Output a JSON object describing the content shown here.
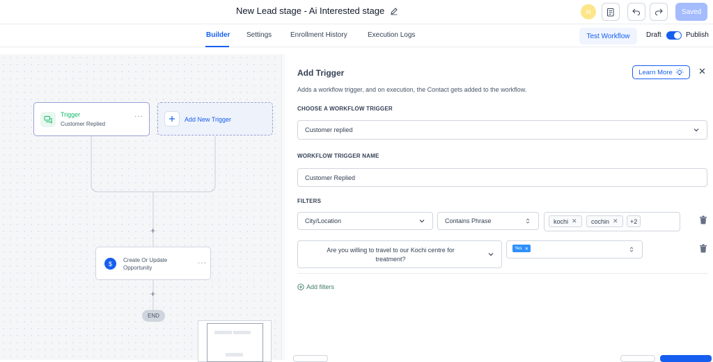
{
  "header": {
    "title": "New Lead stage - Ai Interested stage",
    "avatar_initials": "AI",
    "saved_label": "Saved"
  },
  "tabs": [
    {
      "label": "Builder",
      "active": true
    },
    {
      "label": "Settings",
      "active": false
    },
    {
      "label": "Enrollment History",
      "active": false
    },
    {
      "label": "Execution Logs",
      "active": false
    }
  ],
  "toolbar": {
    "test_workflow_label": "Test Workflow",
    "draft_label": "Draft",
    "publish_label": "Publish",
    "publish_toggle_on": true
  },
  "canvas": {
    "trigger_node": {
      "title": "Trigger",
      "subtitle": "Customer Replied"
    },
    "add_trigger_label": "Add New Trigger",
    "action_node": {
      "title_line1": "Create Or Update",
      "title_line2": "Opportunity"
    },
    "end_label": "END"
  },
  "panel": {
    "title": "Add Trigger",
    "learn_more_label": "Learn More",
    "description": "Adds a workflow trigger, and on execution, the Contact gets added to the workflow.",
    "choose_trigger_label": "CHOOSE A WORKFLOW TRIGGER",
    "trigger_value": "Customer replied",
    "trigger_name_label": "WORKFLOW TRIGGER NAME",
    "trigger_name_value": "Customer Replied",
    "filters_label": "FILTERS",
    "filter1": {
      "field": "City/Location",
      "operator": "Contains Phrase",
      "chips": [
        "kochi",
        "cochin"
      ],
      "more": "+2"
    },
    "filter2": {
      "field_line1": "Are you willing to travel to our Kochi centre for",
      "field_line2": "treatment?",
      "chip": "Yes"
    },
    "add_filters_label": "Add filters"
  },
  "colors": {
    "accent": "#155eef",
    "trigger_green": "#12b76a",
    "saved_bg": "#a4bcfd"
  }
}
